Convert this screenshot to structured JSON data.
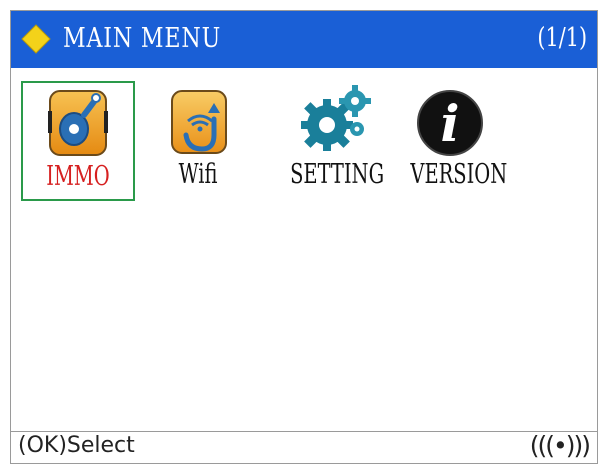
{
  "header": {
    "title": "MAIN MENU",
    "page_indicator": "(1/1)",
    "background_color": "#1a5fd6",
    "icon": "yellow-diamond-icon"
  },
  "menu": {
    "items": [
      {
        "label": "IMMO",
        "icon": "key-remote-icon",
        "selected": true
      },
      {
        "label": "Wifi",
        "icon": "wifi-hand-icon",
        "selected": false
      },
      {
        "label": "SETTING",
        "icon": "gears-icon",
        "selected": false
      },
      {
        "label": "VERSION",
        "icon": "info-icon",
        "selected": false
      }
    ],
    "selected_label_color": "#d62020",
    "selection_border_color": "#2a9a4a"
  },
  "footer": {
    "hint": "(OK)Select",
    "signal": "(((•)))"
  }
}
